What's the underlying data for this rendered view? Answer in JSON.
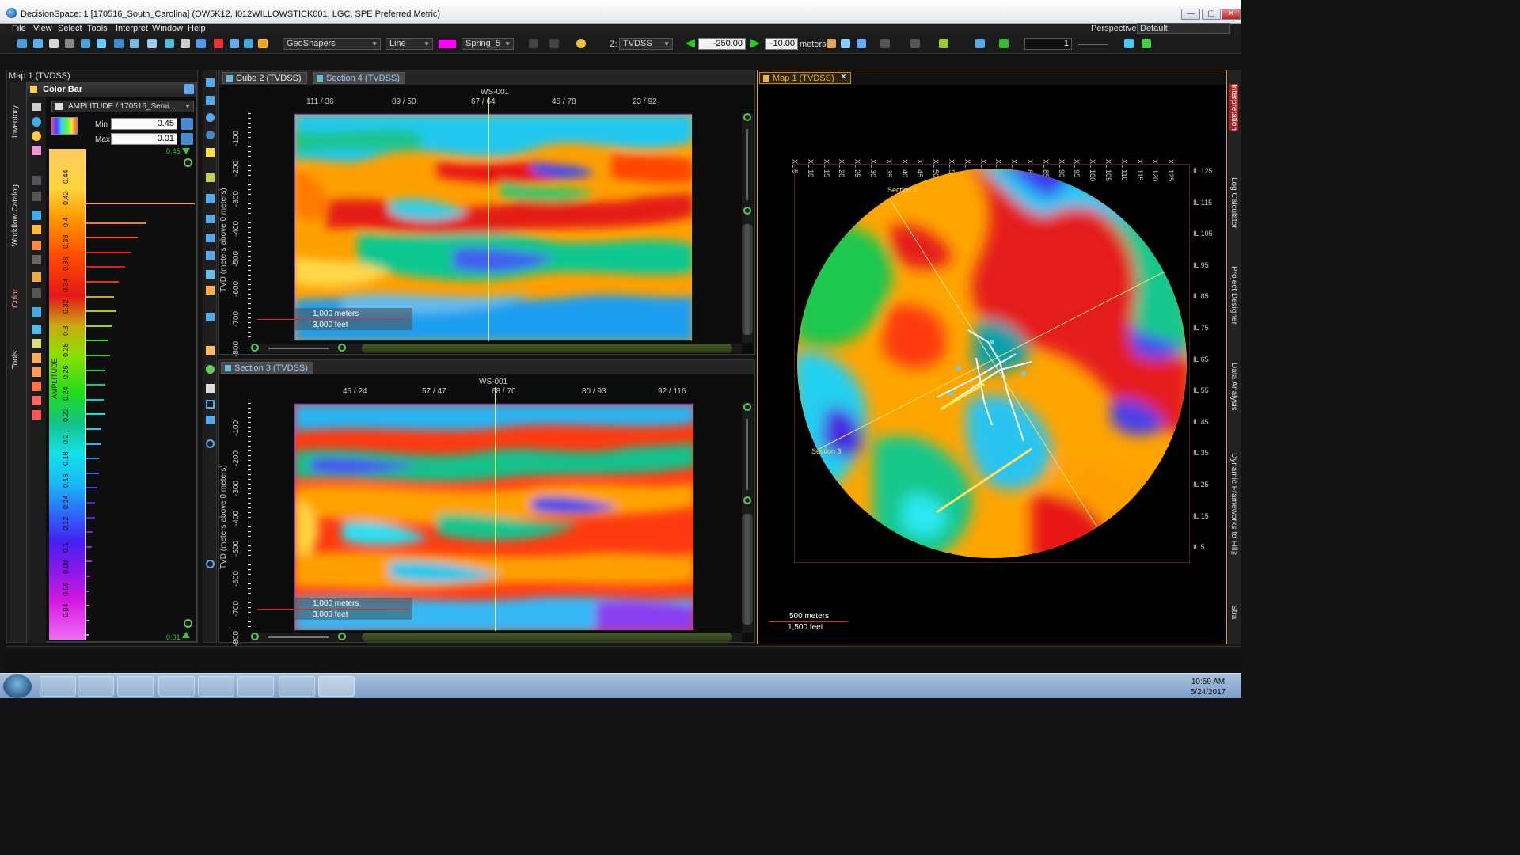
{
  "window": {
    "title": "DecisionSpace: 1 [170516_South_Carolina] (OW5K12, I012WILLOWSTICK001, LGC, SPE Preferred Metric)",
    "controls": [
      "—",
      "▢",
      "✕"
    ]
  },
  "menu": {
    "items": [
      "File",
      "View",
      "Select",
      "Tools",
      "Interpret",
      "Window",
      "Help"
    ],
    "perspective_label": "Perspective:",
    "perspective_value": "Default"
  },
  "toolbar": {
    "geoshapers": "GeoShapers",
    "line_mode": "Line",
    "line_color": "#ff00ff",
    "color_map": "Spring_5",
    "z_label": "Z:",
    "z_domain": "TVDSS",
    "depth_start": "-250.00",
    "depth_end": "-10.00",
    "units": "meters",
    "step": "1"
  },
  "left_panel": {
    "title": "Map 1 (TVDSS)",
    "vertical_tabs": [
      "Inventory",
      "Workflow Catalog",
      "Color",
      "Tools"
    ],
    "color_bar": {
      "header": "Color Bar",
      "attribute": "AMPLITUDE / 170516_Semi...",
      "min_label": "Min",
      "min_value": "0.45",
      "max_label": "Max",
      "max_value": "0.01",
      "top_value": "0.45",
      "bottom_value": "0.01",
      "axis_title": "AMPLITUDE",
      "ticks": [
        "0.44",
        "0.42",
        "0.4",
        "0.38",
        "0.36",
        "0.34",
        "0.32",
        "0.3",
        "0.28",
        "0.26",
        "0.24",
        "0.22",
        "0.2",
        "0.18",
        "0.16",
        "0.14",
        "0.12",
        "0.1",
        "0.08",
        "0.06",
        "0.04"
      ],
      "histogram": [
        0,
        0.55,
        0.48,
        0.42,
        0.36,
        0.3,
        0.26,
        0.28,
        0.24,
        0.2,
        0.22,
        0.18,
        0.18,
        0.16,
        0.18,
        0.14,
        0.14,
        0.12,
        0.12,
        0.1,
        0.08,
        0.08,
        0.06,
        0.05,
        0.05,
        0.04,
        0.03,
        0.03,
        0.03,
        0.02,
        0.02,
        0.02,
        0.01
      ]
    }
  },
  "section_top": {
    "tabs": [
      "Cube 2 (TVDSS)",
      "Section 4 (TVDSS)"
    ],
    "well": "WS-001",
    "xticks": [
      "111 / 36",
      "89 / 50",
      "67 / 64",
      "45 / 78",
      "23 / 92"
    ],
    "yticks": [
      "-100",
      "-200",
      "-300",
      "-400",
      "-500",
      "-600",
      "-700",
      "-800"
    ],
    "ylabel": "TVD (meters above 0 meters)",
    "scale_meters": "1,000 meters",
    "scale_feet": "3,000 feet"
  },
  "section_bottom": {
    "tabs": [
      "Section 3 (TVDSS)"
    ],
    "well": "WS-001",
    "xticks": [
      "45 / 24",
      "57 / 47",
      "68 / 70",
      "80 / 93",
      "92 / 116"
    ],
    "yticks": [
      "-100",
      "-200",
      "-300",
      "-400",
      "-500",
      "-600",
      "-700",
      "-800"
    ],
    "ylabel": "TVD (meters above 0 meters)",
    "scale_meters": "1,000 meters",
    "scale_feet": "3,000 feet"
  },
  "map": {
    "tab": "Map 1 (TVDSS)",
    "xl_ticks": [
      "XL 5",
      "XL 10",
      "XL 15",
      "XL 20",
      "XL 25",
      "XL 30",
      "XL 35",
      "XL 40",
      "XL 45",
      "XL 50",
      "XL 55",
      "XL 60",
      "XL 65",
      "XL 70",
      "XL 75",
      "XL 80",
      "XL 85",
      "XL 90",
      "XL 95",
      "XL 100",
      "XL 105",
      "XL 110",
      "XL 115",
      "XL 120",
      "XL 125"
    ],
    "il_ticks": [
      "IL 125",
      "IL 115",
      "IL 105",
      "IL 95",
      "IL 85",
      "IL 75",
      "IL 65",
      "IL 55",
      "IL 45",
      "IL 35",
      "IL 25",
      "IL 15",
      "IL 5"
    ],
    "section4_label": "Section 4",
    "section3_label": "Section 3",
    "scale_meters": "500 meters",
    "scale_feet": "1,500 feet"
  },
  "right_dock": [
    "Interpretation",
    "Log Calculator",
    "Project Designer",
    "Data Analysis",
    "Dynamic Frameworks to Fill™",
    "Stra"
  ],
  "taskbar": {
    "time": "10:59 AM",
    "date": "5/24/2017"
  }
}
